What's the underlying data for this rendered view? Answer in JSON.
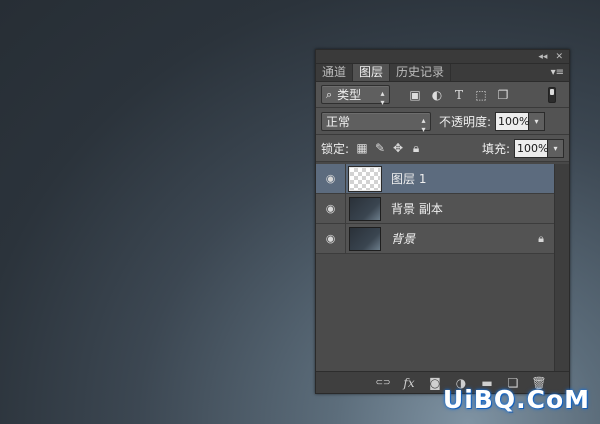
{
  "panel": {
    "titlebar": {
      "collapse_glyph": "◂◂",
      "close_glyph": "✕"
    },
    "tabs": [
      {
        "label": "通道",
        "active": false
      },
      {
        "label": "图层",
        "active": true
      },
      {
        "label": "历史记录",
        "active": false
      }
    ],
    "tab_menu_glyph": "▾≡",
    "filter": {
      "search_glyph": "⌕",
      "label": "类型",
      "arrows": "▴▾",
      "icons": [
        {
          "name": "pixel-filter-icon",
          "glyph": "▣"
        },
        {
          "name": "adjustment-filter-icon",
          "glyph": "◐"
        },
        {
          "name": "type-filter-icon",
          "glyph": "T"
        },
        {
          "name": "shape-filter-icon",
          "glyph": "⬚"
        },
        {
          "name": "smart-object-filter-icon",
          "glyph": "❐"
        }
      ]
    },
    "blend": {
      "mode": "正常",
      "arrows": "▴▾",
      "opacity_label": "不透明度:",
      "opacity_value": "100%",
      "dropdown_glyph": "▾"
    },
    "lock": {
      "label": "锁定:",
      "icons": [
        {
          "name": "lock-transparent-pixels-icon",
          "glyph": "▦"
        },
        {
          "name": "lock-image-pixels-icon",
          "glyph": "✎"
        },
        {
          "name": "lock-position-icon",
          "glyph": "✥"
        },
        {
          "name": "lock-all-icon",
          "glyph": "🔒︎"
        }
      ],
      "fill_label": "填充:",
      "fill_value": "100%",
      "dropdown_glyph": "▾"
    },
    "layers": [
      {
        "name": "图层 1",
        "thumb": "transparent",
        "selected": true,
        "italic": false,
        "locked": false,
        "eye_glyph": "◉"
      },
      {
        "name": "背景 副本",
        "thumb": "dark",
        "selected": false,
        "italic": false,
        "locked": false,
        "eye_glyph": "◉"
      },
      {
        "name": "背景",
        "thumb": "dark",
        "selected": false,
        "italic": true,
        "locked": true,
        "eye_glyph": "◉",
        "lock_glyph": "🔒︎"
      }
    ],
    "footer_icons": [
      {
        "name": "link-layers-icon",
        "glyph": "⊂⊃"
      },
      {
        "name": "layer-style-fx-icon",
        "glyph": "fx"
      },
      {
        "name": "add-mask-icon",
        "glyph": "◙"
      },
      {
        "name": "adjustment-layer-icon",
        "glyph": "◑"
      },
      {
        "name": "new-group-folder-icon",
        "glyph": "▬"
      },
      {
        "name": "new-layer-icon",
        "glyph": "❏"
      },
      {
        "name": "delete-layer-trash-icon",
        "glyph": "🗑︎"
      }
    ]
  },
  "watermark": "UiBQ.CoM"
}
